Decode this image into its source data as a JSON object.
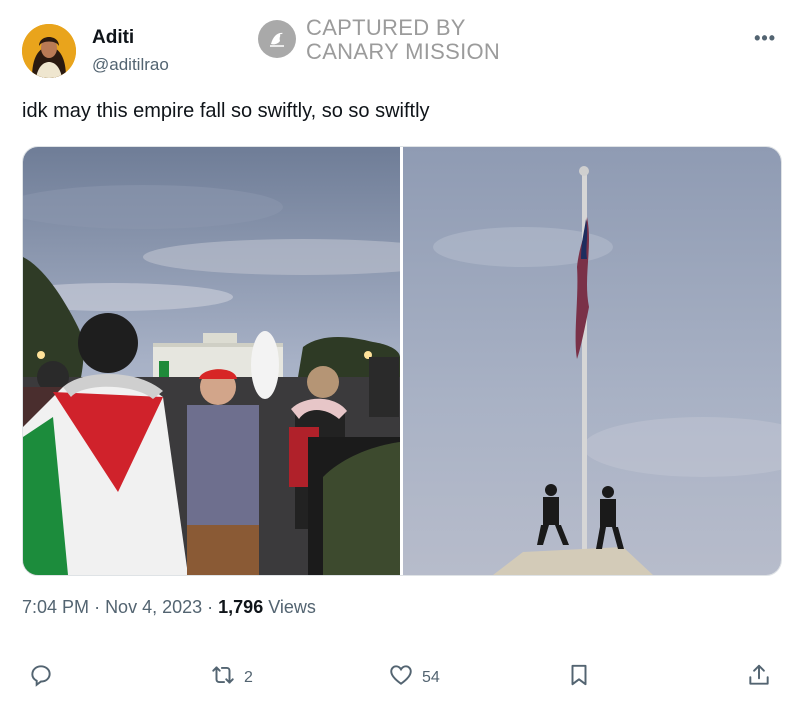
{
  "author": {
    "display_name": "Aditi",
    "handle": "@aditilrao"
  },
  "watermark": {
    "line1": "CAPTURED BY",
    "line2": "CANARY MISSION"
  },
  "tweet": {
    "text": "idk may this empire fall so swiftly, so so swiftly",
    "time": "7:04 PM",
    "date": "Nov 4, 2023",
    "views_count": "1,796",
    "views_label": "Views"
  },
  "actions": {
    "retweets": "2",
    "likes": "54"
  },
  "icons": {
    "more": "more-horizontal-icon",
    "reply": "reply-icon",
    "retweet": "retweet-icon",
    "like": "heart-icon",
    "bookmark": "bookmark-icon",
    "share": "share-icon"
  },
  "colors": {
    "text_primary": "#0f1419",
    "text_secondary": "#536471",
    "watermark": "#9b9b9b"
  }
}
